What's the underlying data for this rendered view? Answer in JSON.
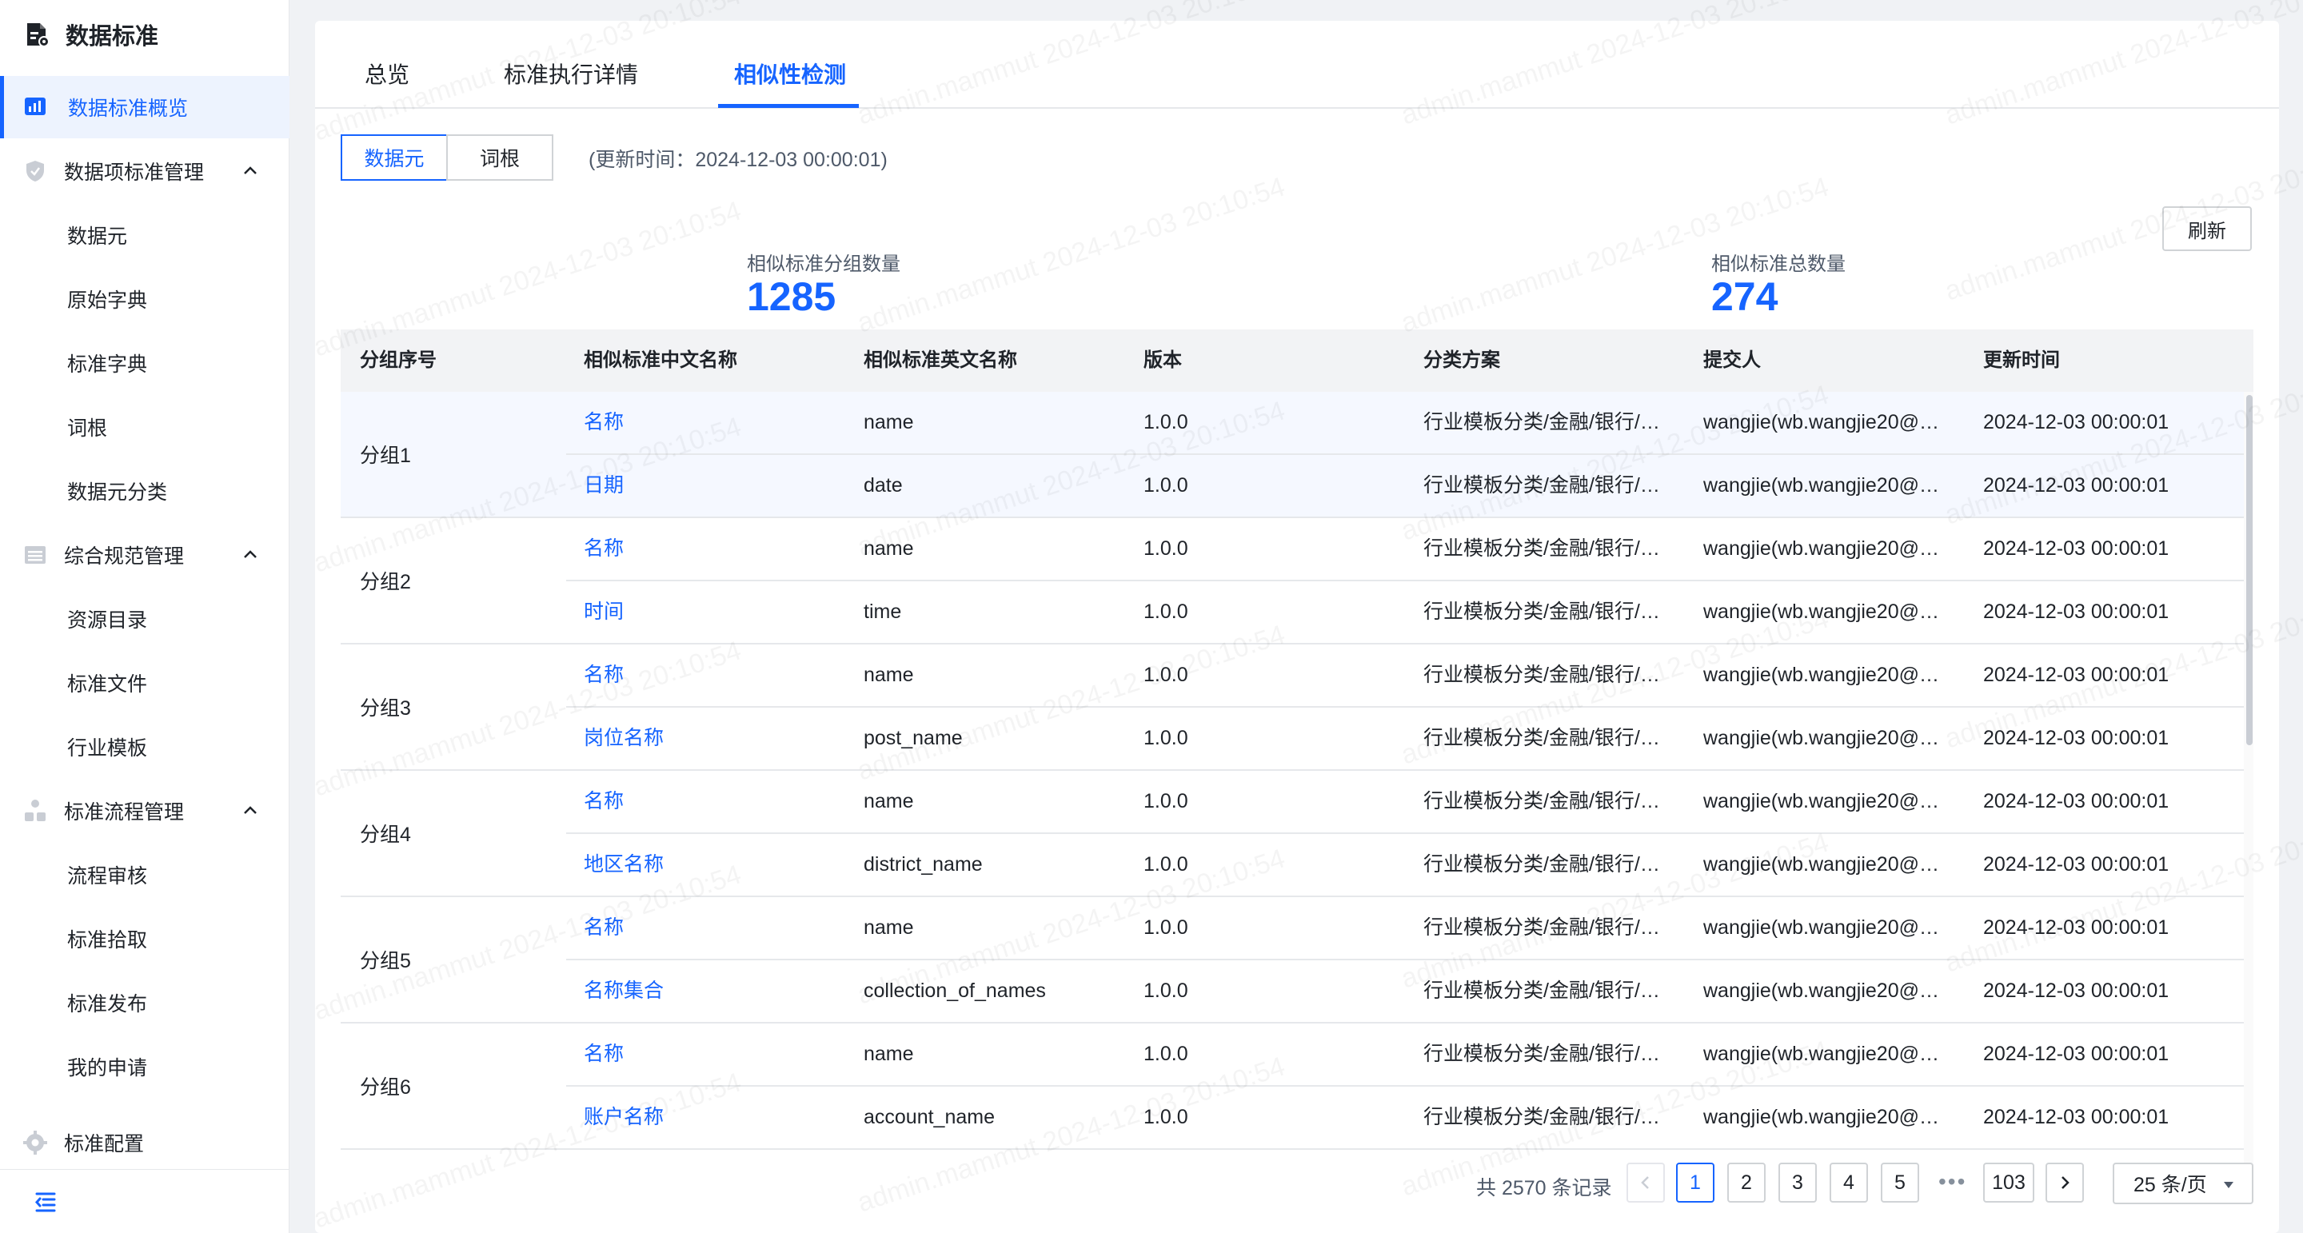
{
  "app": {
    "title": "数据标准"
  },
  "sidebar": {
    "items": [
      {
        "label": "数据标准概览",
        "icon": "chart-icon",
        "active": true
      },
      {
        "label": "数据项标准管理",
        "icon": "shield-icon",
        "expandable": true
      },
      {
        "label": "数据元"
      },
      {
        "label": "原始字典"
      },
      {
        "label": "标准字典"
      },
      {
        "label": "词根"
      },
      {
        "label": "数据元分类"
      },
      {
        "label": "综合规范管理",
        "icon": "list-icon",
        "expandable": true
      },
      {
        "label": "资源目录"
      },
      {
        "label": "标准文件"
      },
      {
        "label": "行业模板"
      },
      {
        "label": "标准流程管理",
        "icon": "hierarchy-icon",
        "expandable": true
      },
      {
        "label": "流程审核"
      },
      {
        "label": "标准拾取"
      },
      {
        "label": "标准发布"
      },
      {
        "label": "我的申请"
      },
      {
        "label": "标准配置",
        "icon": "gear-icon"
      }
    ]
  },
  "tabs": [
    {
      "label": "总览"
    },
    {
      "label": "标准执行详情"
    },
    {
      "label": "相似性检测",
      "active": true
    }
  ],
  "segment": {
    "options": [
      "数据元",
      "词根"
    ],
    "selected": "数据元"
  },
  "update_time": "(更新时间：2024-12-03 00:00:01)",
  "refresh_label": "刷新",
  "stats": {
    "group_count_label": "相似标准分组数量",
    "group_count": "1285",
    "total_label": "相似标准总数量",
    "total": "274"
  },
  "table": {
    "columns": [
      "分组序号",
      "相似标准中文名称",
      "相似标准英文名称",
      "版本",
      "分类方案",
      "提交人",
      "更新时间"
    ],
    "groups": [
      {
        "group": "分组1",
        "rows": [
          {
            "cn": "名称",
            "en": "name",
            "version": "1.0.0",
            "scheme": "行业模板分类/金融/银行/…",
            "submitter": "wangjie(wb.wangjie20@…",
            "updated": "2024-12-03 00:00:01"
          },
          {
            "cn": "日期",
            "en": "date",
            "version": "1.0.0",
            "scheme": "行业模板分类/金融/银行/…",
            "submitter": "wangjie(wb.wangjie20@…",
            "updated": "2024-12-03 00:00:01"
          }
        ]
      },
      {
        "group": "分组2",
        "rows": [
          {
            "cn": "名称",
            "en": "name",
            "version": "1.0.0",
            "scheme": "行业模板分类/金融/银行/…",
            "submitter": "wangjie(wb.wangjie20@…",
            "updated": "2024-12-03 00:00:01"
          },
          {
            "cn": "时间",
            "en": "time",
            "version": "1.0.0",
            "scheme": "行业模板分类/金融/银行/…",
            "submitter": "wangjie(wb.wangjie20@…",
            "updated": "2024-12-03 00:00:01"
          }
        ]
      },
      {
        "group": "分组3",
        "rows": [
          {
            "cn": "名称",
            "en": "name",
            "version": "1.0.0",
            "scheme": "行业模板分类/金融/银行/…",
            "submitter": "wangjie(wb.wangjie20@…",
            "updated": "2024-12-03 00:00:01"
          },
          {
            "cn": "岗位名称",
            "en": "post_name",
            "version": "1.0.0",
            "scheme": "行业模板分类/金融/银行/…",
            "submitter": "wangjie(wb.wangjie20@…",
            "updated": "2024-12-03 00:00:01"
          }
        ]
      },
      {
        "group": "分组4",
        "rows": [
          {
            "cn": "名称",
            "en": "name",
            "version": "1.0.0",
            "scheme": "行业模板分类/金融/银行/…",
            "submitter": "wangjie(wb.wangjie20@…",
            "updated": "2024-12-03 00:00:01"
          },
          {
            "cn": "地区名称",
            "en": "district_name",
            "version": "1.0.0",
            "scheme": "行业模板分类/金融/银行/…",
            "submitter": "wangjie(wb.wangjie20@…",
            "updated": "2024-12-03 00:00:01"
          }
        ]
      },
      {
        "group": "分组5",
        "rows": [
          {
            "cn": "名称",
            "en": "name",
            "version": "1.0.0",
            "scheme": "行业模板分类/金融/银行/…",
            "submitter": "wangjie(wb.wangjie20@…",
            "updated": "2024-12-03 00:00:01"
          },
          {
            "cn": "名称集合",
            "en": "collection_of_names",
            "version": "1.0.0",
            "scheme": "行业模板分类/金融/银行/…",
            "submitter": "wangjie(wb.wangjie20@…",
            "updated": "2024-12-03 00:00:01"
          }
        ]
      },
      {
        "group": "分组6",
        "rows": [
          {
            "cn": "名称",
            "en": "name",
            "version": "1.0.0",
            "scheme": "行业模板分类/金融/银行/…",
            "submitter": "wangjie(wb.wangjie20@…",
            "updated": "2024-12-03 00:00:01"
          },
          {
            "cn": "账户名称",
            "en": "account_name",
            "version": "1.0.0",
            "scheme": "行业模板分类/金融/银行/…",
            "submitter": "wangjie(wb.wangjie20@…",
            "updated": "2024-12-03 00:00:01"
          }
        ]
      }
    ]
  },
  "pagination": {
    "total": "共 2570 条记录",
    "pages": [
      "1",
      "2",
      "3",
      "4",
      "5"
    ],
    "ellipsis": "•••",
    "last": "103",
    "current": "1",
    "page_size": "25 条/页"
  },
  "watermark": "admin.mammut 2024-12-03 20:10:54",
  "colors": {
    "accent": "#1664ff",
    "highlight_row": "#f5f8ff"
  }
}
